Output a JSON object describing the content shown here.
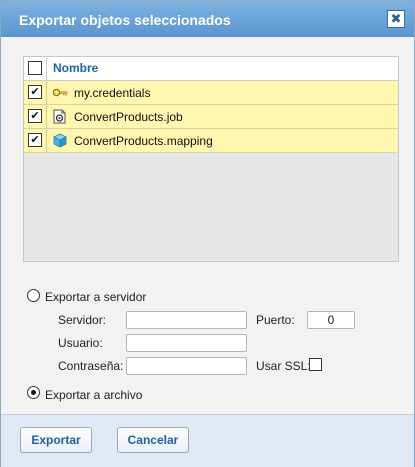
{
  "dialog": {
    "title": "Exportar objetos seleccionados",
    "close_label": "✖"
  },
  "list": {
    "column_header": "Nombre",
    "header_checked": false,
    "items": [
      {
        "label": "my.credentials",
        "icon": "key-icon",
        "checked": true
      },
      {
        "label": "ConvertProducts.job",
        "icon": "job-icon",
        "checked": true
      },
      {
        "label": "ConvertProducts.mapping",
        "icon": "mapping-cube-icon",
        "checked": true
      }
    ]
  },
  "export_server": {
    "label": "Exportar a servidor",
    "selected": false,
    "server_label": "Servidor:",
    "server_value": "",
    "port_label": "Puerto:",
    "port_value": "0",
    "user_label": "Usuario:",
    "user_value": "",
    "password_label": "Contraseña:",
    "password_value": "",
    "ssl_label": "Usar SSL:",
    "ssl_checked": false
  },
  "export_file": {
    "label": "Exportar a archivo",
    "selected": true
  },
  "buttons": {
    "export_label": "Exportar",
    "cancel_label": "Cancelar"
  },
  "colors": {
    "title_bar": "#6aa3d8",
    "row_highlight": "#fff6b0",
    "accent_text": "#1f63a8",
    "footer": "#dfe8f3"
  }
}
